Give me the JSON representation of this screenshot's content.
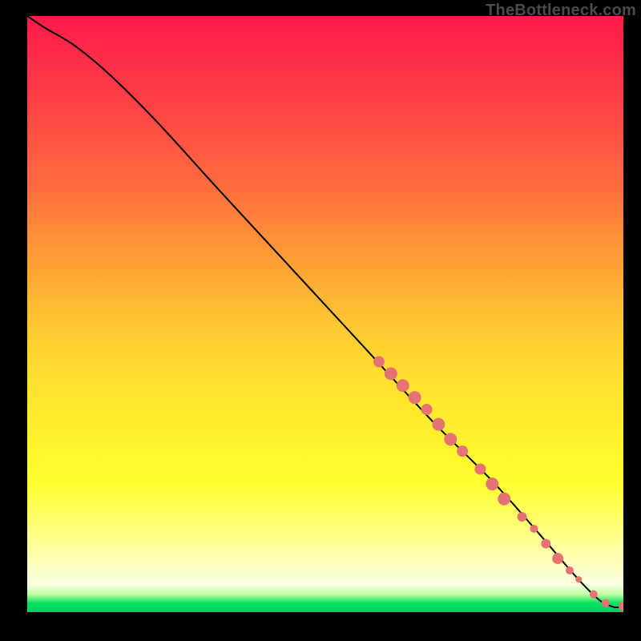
{
  "watermark": {
    "text": "TheBottleneck.com"
  },
  "colors": {
    "curve_stroke": "#000000",
    "marker_fill": "#e57373",
    "background": "#000000"
  },
  "chart_data": {
    "type": "line",
    "title": "",
    "xlabel": "",
    "ylabel": "",
    "xlim": [
      0,
      100
    ],
    "ylim": [
      0,
      100
    ],
    "grid": false,
    "legend": false,
    "notes": "Axes are unlabeled in the source image; x and y are normalized 0–100 in plot-area coordinates (origin bottom-left). Curve is a smooth monotone decreasing line from top-left to bottom-right. Markers sit on the curve in its lower-right third, plus one terminal marker at the far right.",
    "series": [
      {
        "name": "curve",
        "kind": "line",
        "x": [
          0,
          3,
          8,
          14,
          22,
          32,
          44,
          56,
          68,
          78,
          86,
          92,
          96,
          98.5
        ],
        "y": [
          100,
          98,
          95,
          90,
          82,
          71,
          58,
          45,
          32,
          22,
          13,
          6,
          2,
          0.8
        ]
      },
      {
        "name": "markers",
        "kind": "scatter",
        "points": [
          {
            "x": 59,
            "y": 42,
            "r": 7
          },
          {
            "x": 61,
            "y": 40,
            "r": 8
          },
          {
            "x": 63,
            "y": 38,
            "r": 8
          },
          {
            "x": 65,
            "y": 36,
            "r": 8
          },
          {
            "x": 67,
            "y": 34,
            "r": 7
          },
          {
            "x": 69,
            "y": 31.5,
            "r": 8
          },
          {
            "x": 71,
            "y": 29,
            "r": 8
          },
          {
            "x": 73,
            "y": 27,
            "r": 7
          },
          {
            "x": 76,
            "y": 24,
            "r": 7
          },
          {
            "x": 78,
            "y": 21.5,
            "r": 8
          },
          {
            "x": 80,
            "y": 19,
            "r": 8
          },
          {
            "x": 83,
            "y": 16,
            "r": 6
          },
          {
            "x": 85,
            "y": 14,
            "r": 5
          },
          {
            "x": 87,
            "y": 11.5,
            "r": 6
          },
          {
            "x": 89,
            "y": 9,
            "r": 7
          },
          {
            "x": 91,
            "y": 7,
            "r": 5
          },
          {
            "x": 92.5,
            "y": 5.5,
            "r": 4
          },
          {
            "x": 95,
            "y": 3,
            "r": 5
          },
          {
            "x": 97,
            "y": 1.5,
            "r": 5
          },
          {
            "x": 100,
            "y": 1,
            "r": 6
          }
        ]
      }
    ]
  }
}
